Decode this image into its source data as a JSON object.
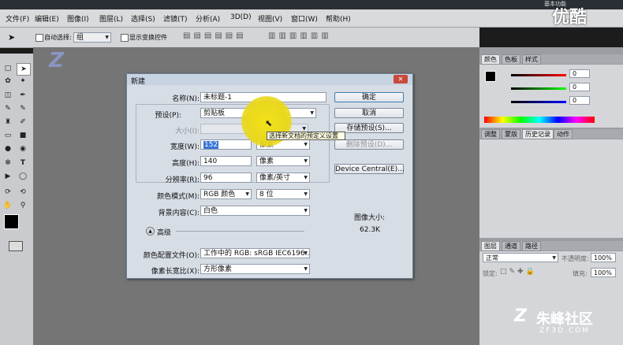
{
  "titlebar": {
    "workspace": "基本功能",
    "watermark": "优酷"
  },
  "menu": [
    "文件(F)",
    "编辑(E)",
    "图像(I)",
    "图层(L)",
    "选择(S)",
    "滤镜(T)",
    "分析(A)",
    "3D(D)",
    "视图(V)",
    "窗口(W)",
    "帮助(H)"
  ],
  "options": {
    "auto_select_label": "自动选择:",
    "auto_select_value": "组",
    "show_transform_label": "显示变换控件"
  },
  "panels": {
    "color_tabs": [
      "颜色",
      "色板",
      "样式"
    ],
    "color_values": [
      "0",
      "0",
      "0"
    ],
    "history_tabs": [
      "调整",
      "蒙版",
      "历史记录",
      "动作"
    ],
    "layer_tabs": [
      "图层",
      "通道",
      "路径"
    ],
    "blend_mode": "正常",
    "opacity_label": "不透明度:",
    "opacity_value": "100%",
    "lock_label": "锁定:",
    "fill_label": "填充:",
    "fill_value": "100%"
  },
  "dialog": {
    "title": "新建",
    "name_label": "名称(N):",
    "name_value": "未标题-1",
    "preset_label": "预设(P):",
    "preset_value": "剪贴板",
    "size_label": "大小(I):",
    "width_label": "宽度(W):",
    "width_value": "152",
    "width_unit": "像素",
    "height_label": "高度(H):",
    "height_value": "140",
    "height_unit": "像素",
    "resolution_label": "分辨率(R):",
    "resolution_value": "96",
    "resolution_unit": "像素/英寸",
    "color_mode_label": "颜色模式(M):",
    "color_mode_value": "RGB 颜色",
    "bit_depth": "8 位",
    "background_label": "背景内容(C):",
    "background_value": "白色",
    "advanced_label": "高级",
    "color_profile_label": "颜色配置文件(O):",
    "color_profile_value": "工作中的 RGB: sRGB IEC6196...",
    "pixel_aspect_label": "像素长宽比(X):",
    "pixel_aspect_value": "方形像素",
    "ok_button": "确定",
    "cancel_button": "取消",
    "save_preset_button": "存储预设(S)...",
    "delete_preset_button": "删除预设(D)...",
    "device_central_button": "Device Central(E)...",
    "image_size_label": "图像大小:",
    "image_size_value": "62.3K"
  },
  "tooltip": "选择新文档的预定义设置",
  "watermark": {
    "brand": "朱峰社区",
    "url": "ZF3D.COM"
  }
}
